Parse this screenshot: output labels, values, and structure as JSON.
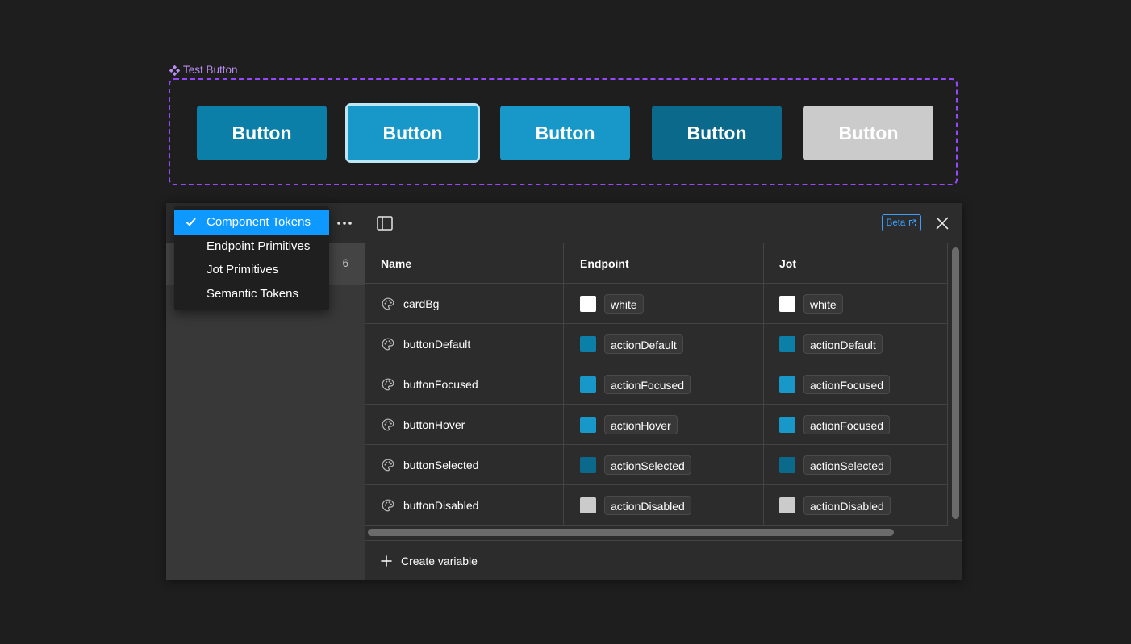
{
  "component_frame": {
    "label": "Test Button",
    "buttons": [
      {
        "label": "Button",
        "state": "default",
        "color": "#0b7fa8"
      },
      {
        "label": "Button",
        "state": "focused",
        "color": "#1898c8"
      },
      {
        "label": "Button",
        "state": "hover",
        "color": "#1898c8"
      },
      {
        "label": "Button",
        "state": "selected",
        "color": "#0b6a8c"
      },
      {
        "label": "Button",
        "state": "disabled",
        "color": "#cbcbcb"
      }
    ]
  },
  "collections_menu": {
    "items": [
      {
        "label": "Component Tokens",
        "selected": true
      },
      {
        "label": "Endpoint Primitives",
        "selected": false
      },
      {
        "label": "Jot Primitives",
        "selected": false
      },
      {
        "label": "Semantic Tokens",
        "selected": false
      }
    ]
  },
  "sidebar": {
    "collection_count": "6"
  },
  "header": {
    "beta_label": "Beta"
  },
  "table": {
    "columns": [
      "Name",
      "Endpoint",
      "Jot"
    ],
    "rows": [
      {
        "name": "cardBg",
        "endpoint": {
          "alias": "white",
          "color": "#ffffff"
        },
        "jot": {
          "alias": "white",
          "color": "#ffffff"
        }
      },
      {
        "name": "buttonDefault",
        "endpoint": {
          "alias": "actionDefault",
          "color": "#0b7fa8"
        },
        "jot": {
          "alias": "actionDefault",
          "color": "#0b7fa8"
        }
      },
      {
        "name": "buttonFocused",
        "endpoint": {
          "alias": "actionFocused",
          "color": "#1898c8"
        },
        "jot": {
          "alias": "actionFocused",
          "color": "#1898c8"
        }
      },
      {
        "name": "buttonHover",
        "endpoint": {
          "alias": "actionHover",
          "color": "#1898c8"
        },
        "jot": {
          "alias": "actionFocused",
          "color": "#1898c8"
        }
      },
      {
        "name": "buttonSelected",
        "endpoint": {
          "alias": "actionSelected",
          "color": "#0b6a8c"
        },
        "jot": {
          "alias": "actionSelected",
          "color": "#0b6a8c"
        }
      },
      {
        "name": "buttonDisabled",
        "endpoint": {
          "alias": "actionDisabled",
          "color": "#cbcbcb"
        },
        "jot": {
          "alias": "actionDisabled",
          "color": "#cbcbcb"
        }
      }
    ]
  },
  "footer": {
    "create_label": "Create variable"
  }
}
